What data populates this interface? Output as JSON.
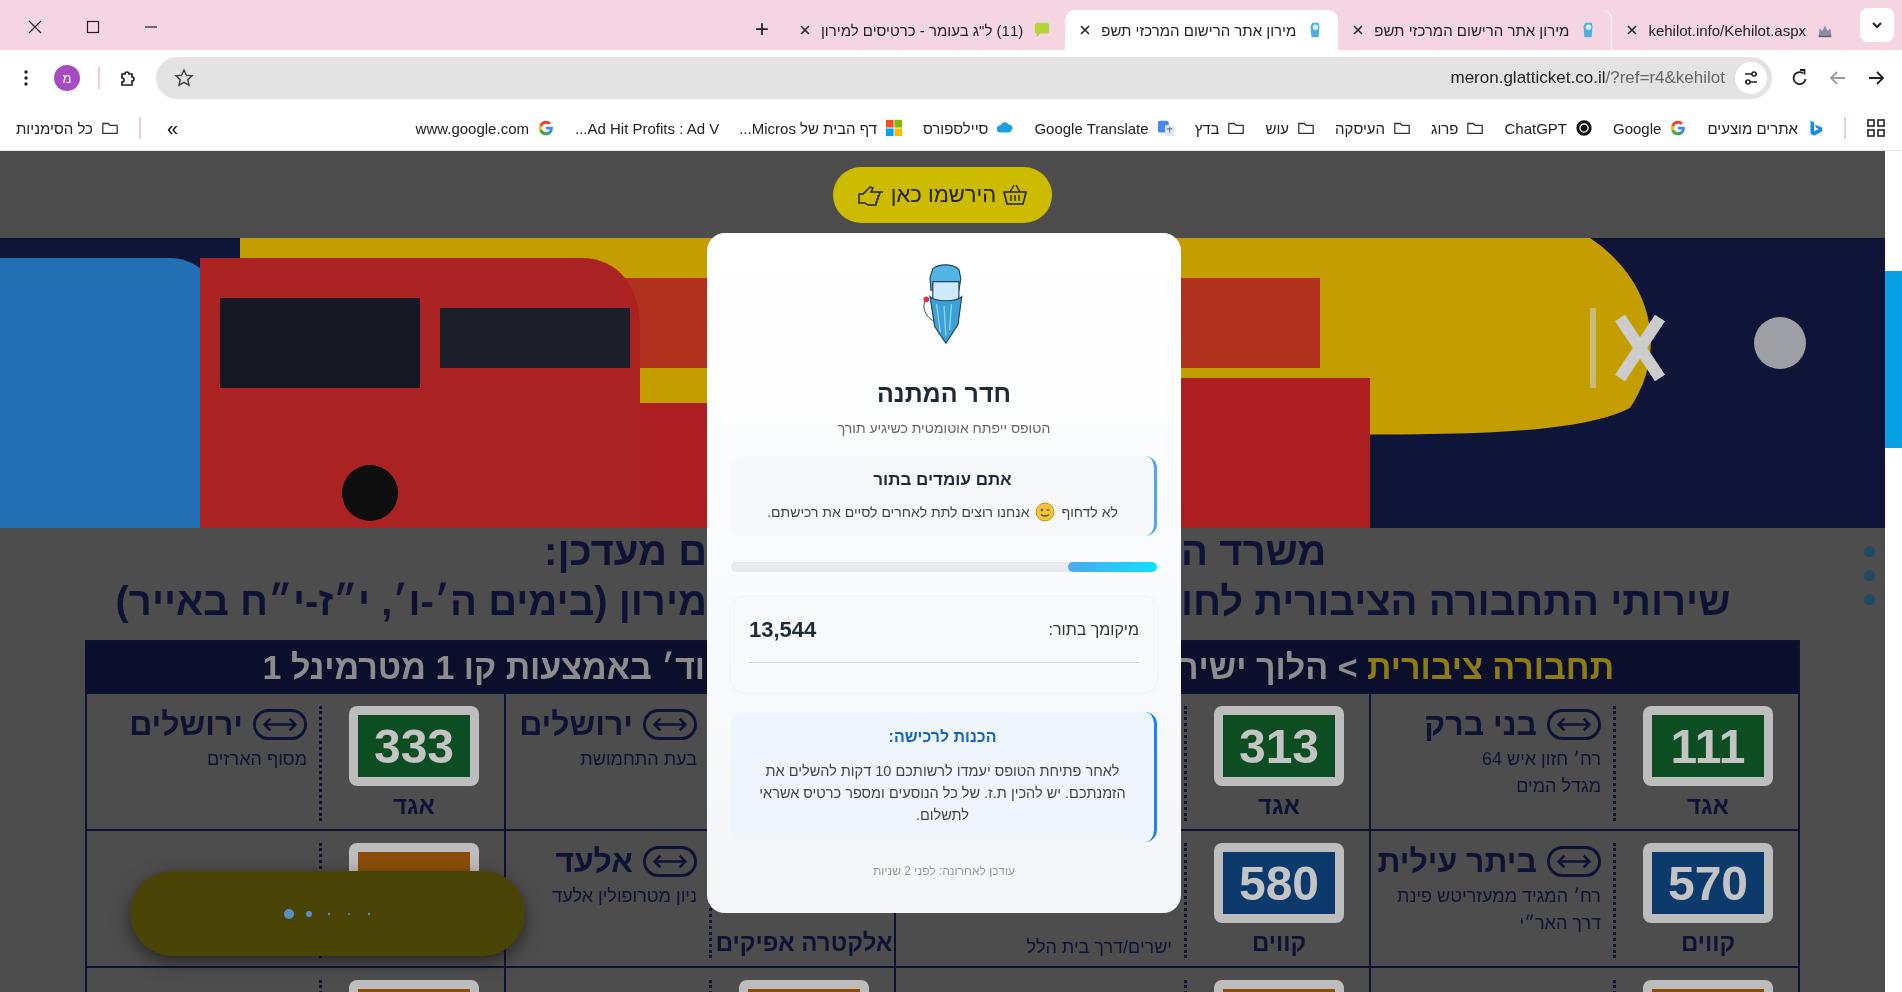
{
  "browser": {
    "tabs": [
      {
        "title": "kehilot.info/Kehilot.aspx",
        "selected": false
      },
      {
        "title": "מירון אתר הרישום המרכזי תשפ",
        "selected": false
      },
      {
        "title": "מירון אתר הרישום המרכזי תשפ",
        "selected": true
      },
      {
        "title": "(11) ל\"ג בעומר - כרטיסים למירון",
        "selected": false
      }
    ],
    "new_tab": "+",
    "address": {
      "host": "meron.glatticket.co.il",
      "rest": "/?ref=r4&kehilot"
    },
    "profile": "מ",
    "bookmarks": [
      {
        "label": "אתרים מוצעים",
        "kind": "site"
      },
      {
        "label": "Google",
        "kind": "site"
      },
      {
        "label": "ChatGPT",
        "kind": "site"
      },
      {
        "label": "פרוג",
        "kind": "folder"
      },
      {
        "label": "העיסקה",
        "kind": "folder"
      },
      {
        "label": "עוש",
        "kind": "folder"
      },
      {
        "label": "בדץ",
        "kind": "folder"
      },
      {
        "label": "Google Translate",
        "kind": "site"
      },
      {
        "label": "סיילספורס",
        "kind": "site"
      },
      {
        "label": "דף הבית של Micros...",
        "kind": "site"
      },
      {
        "label": "Ad Hit Profits : Ad V...",
        "kind": "text"
      },
      {
        "label": "www.google.com",
        "kind": "site"
      }
    ],
    "overflow": "»",
    "all_bookmarks": "כל הסימניות"
  },
  "page": {
    "register_button": "הירשמו כאן",
    "headings": [
      {
        "right": "משרד ה",
        "left": "ם מעדכן:"
      },
      {
        "right": "שירותי התחבורה הציבורית לחו",
        "left": "מירון (בימים ה׳-ו׳, י״ז-י״ח באייר)"
      }
    ],
    "table_header": {
      "highlight": "תחבורה ציבורית",
      "text": "> הלוך ישיר",
      "left": "וד׳ באמצעות קו 1 מטרמינל 1"
    },
    "rows": [
      [
        {
          "route": "111",
          "operator": "אגד",
          "color": "#0d4d22",
          "city": "בני ברק",
          "lines": [
            "רח׳ חזון איש 64",
            "מגדל המים"
          ]
        },
        {
          "route": "313",
          "operator": "אגד",
          "color": "#0d4d22"
        },
        {
          "city": "ירושלים",
          "lines": [
            "בעת התחמושת"
          ]
        },
        {
          "route": "333",
          "operator": "אגד",
          "color": "#0d4d22",
          "city": "ירושלים",
          "lines": [
            "מסוף הארזים"
          ]
        }
      ],
      [
        {
          "route": "570",
          "operator": "קווים",
          "color": "#0c3a6c",
          "city": "ביתר עילית",
          "lines": [
            "רח׳ המגיד ממעזריטש פינת",
            "דרך האר״י"
          ]
        },
        {
          "route": "580",
          "operator": "קווים",
          "color": "#0c3a6c",
          "lines": [
            "ישרים/דרך בית הלל"
          ]
        },
        {
          "operator": "אלקטרה אפיקים",
          "city": "אלעד",
          "lines": [
            "ניון מטרופולין אלעד"
          ]
        },
        {
          "color": "#8a4e0a"
        }
      ],
      [
        {
          "color": "#8a4e0a"
        },
        {
          "color": "#8a4e0a"
        },
        {
          "color": "#8a4e0a"
        },
        {
          "color": "#8a4e0a"
        }
      ]
    ]
  },
  "modal": {
    "title": "חדר המתנה",
    "subtitle": "הטופס ייפתח אוטומטית כשיגיע תורך",
    "queue": {
      "title": "אתם עומדים בתור",
      "before": "לא לדחוף",
      "after": "אנחנו רוצים לתת לאחרים לסיים את רכישתם."
    },
    "progress": {
      "level": 0.21
    },
    "position": {
      "label": "מיקומך בתור:",
      "value": "13,544"
    },
    "prep": {
      "title": "הכנות לרכישה:",
      "text": "לאחר פתיחת הטופס יעמדו לרשותכם 10 דקות להשלים את הזמנתכם. יש להכין ת.ז. של כל הנוסעים ומספר כרטיס אשראי לתשלום."
    },
    "updated": "עודכן לאחרונה: לפני 2 שניות"
  }
}
